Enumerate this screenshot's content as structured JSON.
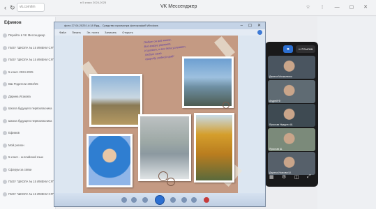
{
  "browser": {
    "address": "vk.com/im",
    "title": "VK Мессенджер",
    "notification": "в 5 класс 2024-2025"
  },
  "sidebar": {
    "header": "Ефимов",
    "items": [
      {
        "label": "Перейти в VK Мессенджер"
      },
      {
        "label": "ГБОУ \"ШКОЛА № 15 ИМЕНИ СЯ\""
      },
      {
        "label": "ГБОУ \"ШКОЛА № 15 ИМЕНИ СЯ\""
      },
      {
        "label": "5 класс 2024-2025"
      },
      {
        "label": "ВШ Родители 2024/25"
      },
      {
        "label": "Дарина Исакова"
      },
      {
        "label": "Школа будущего первокласника"
      },
      {
        "label": "Школа будущего первокласника"
      },
      {
        "label": "Ефимов"
      },
      {
        "label": "Мой регион"
      },
      {
        "label": "5 класс - английский язык"
      },
      {
        "label": "Сферум за связи"
      },
      {
        "label": "ГБОУ \"ШКОЛА № 15 ИМЕНИ СЯ\""
      },
      {
        "label": "ГБОУ \"ШКОЛА № 15 ИМЕНИ СЯ\""
      }
    ]
  },
  "viewer": {
    "title": "фото 27.04.2025 14:18 Ярд... Средство просмотра фотографий Windows",
    "menu": [
      "Файл",
      "Печать",
      "Эл. почта",
      "Записать",
      "Открыть"
    ]
  },
  "poem": [
    "Любит он всё живое,",
    "Всё вокруг уважает,",
    "И гуляет, и все дела успевает,",
    "Любит свою",
    "природу, родной край!"
  ],
  "call": {
    "share_label": "Ссылка",
    "participants": [
      {
        "name": "Данила Москаленко"
      },
      {
        "name": "Андрей Ф."
      },
      {
        "name": "Ярослав Недорез Ш."
      },
      {
        "name": "Ярослав Ш."
      },
      {
        "name": "Дарина Исакова Ш."
      }
    ]
  },
  "colors": {
    "vk_blue": "#2c6fd1",
    "page_brown": "#c49a83",
    "call_dark": "#19191a",
    "poem_purple": "#5a3aa8"
  }
}
